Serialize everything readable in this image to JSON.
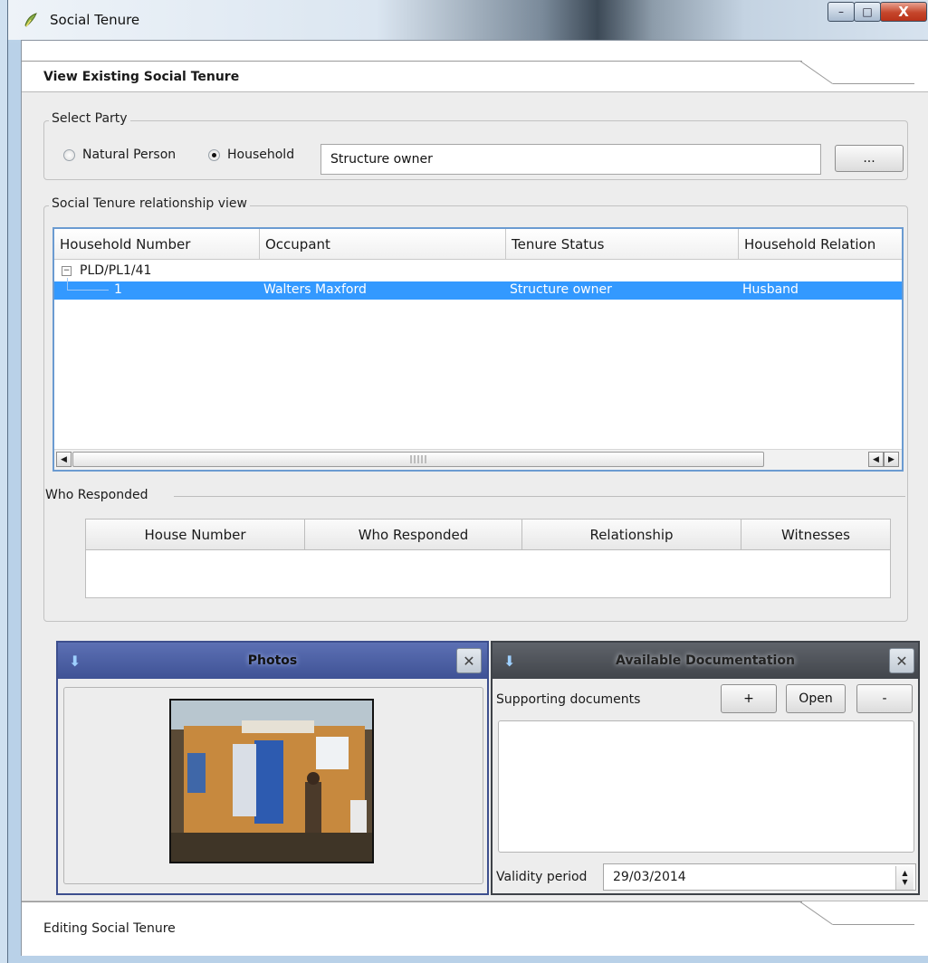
{
  "window": {
    "title": "Social Tenure",
    "controls": {
      "minimize": "–",
      "maximize": "□",
      "close": "X"
    }
  },
  "page": {
    "header_title": "View Existing Social Tenure",
    "footer_text": "Editing Social Tenure"
  },
  "select_party": {
    "group_title": "Select Party",
    "options": [
      {
        "label": "Natural Person",
        "selected": false
      },
      {
        "label": "Household",
        "selected": true
      }
    ],
    "value": "Structure owner",
    "browse_label": "..."
  },
  "relationship_view": {
    "group_title": "Social Tenure relationship view",
    "columns": [
      "Household Number",
      "Occupant",
      "Tenure Status",
      "Household Relation"
    ],
    "tree": [
      {
        "label": "PLD/PL1/41",
        "children": [
          {
            "cells": [
              "1",
              "Walters Maxford",
              "Structure owner",
              "Husband"
            ],
            "selected": true
          }
        ]
      }
    ]
  },
  "who_responded": {
    "title": "Who Responded",
    "columns": [
      "House Number",
      "Who Responded",
      "Relationship",
      "Witnesses"
    ]
  },
  "photos_dock": {
    "title": "Photos",
    "arrow_icon": "down-arrow-icon",
    "close": "✕"
  },
  "docs_dock": {
    "title": "Available Documentation",
    "arrow_icon": "down-arrow-icon",
    "close": "✕",
    "supporting_label": "Supporting documents",
    "add_label": "+",
    "open_label": "Open",
    "remove_label": "-",
    "validity_label": "Validity period",
    "validity_value": "29/03/2014"
  },
  "colors": {
    "selection": "#3399ff",
    "photos_title_bg": "#4a5da0",
    "docs_title_bg": "#4a4e55",
    "close_button": "#c5462b"
  }
}
